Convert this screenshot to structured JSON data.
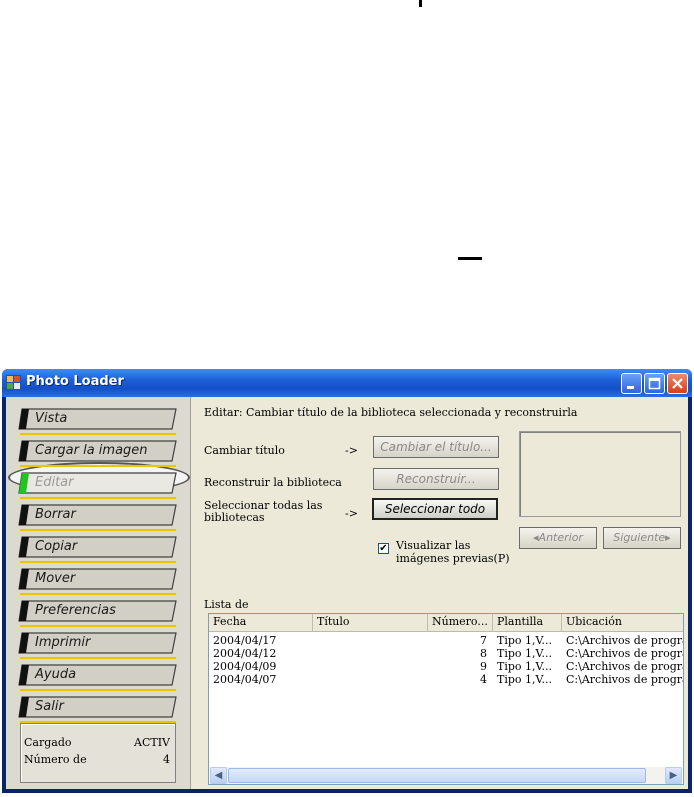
{
  "window": {
    "title": "Photo Loader"
  },
  "sidebar": {
    "items": [
      {
        "label": "Vista",
        "enabled": true
      },
      {
        "label": "Cargar la imagen",
        "enabled": true
      },
      {
        "label": "Editar",
        "enabled": false,
        "highlighted": true
      },
      {
        "label": "Borrar",
        "enabled": true
      },
      {
        "label": "Copiar",
        "enabled": true
      },
      {
        "label": "Mover",
        "enabled": true
      },
      {
        "label": "Preferencias",
        "enabled": true
      },
      {
        "label": "Imprimir",
        "enabled": true
      },
      {
        "label": "Ayuda",
        "enabled": true
      },
      {
        "label": "Salir",
        "enabled": true
      }
    ],
    "status": {
      "loaded_label": "Cargado",
      "loaded_value": "ACTIV",
      "number_label": "Número de",
      "number_value": "4"
    }
  },
  "main": {
    "description": "Editar: Cambiar título de la biblioteca seleccionada y reconstruirla",
    "actions": {
      "change_title_label": "Cambiar título",
      "change_title_arrow": "->",
      "change_title_button": "Cambiar el título...",
      "rebuild_label": "Reconstruir la biblioteca",
      "rebuild_button": "Reconstruir...",
      "select_all_label_line1": "Seleccionar todas las",
      "select_all_label_line2": "bibliotecas",
      "select_all_arrow": "->",
      "select_all_button": "Seleccionar todo"
    },
    "preview": {
      "checkbox_checked": true,
      "checkbox_label_line1": "Visualizar las",
      "checkbox_label_line2": "imágenes previas(P)",
      "prev_button": "Anterior",
      "next_button": "Siguiente"
    },
    "list": {
      "caption": "Lista de",
      "columns": [
        "Fecha",
        "Título",
        "Número...",
        "Plantilla",
        "Ubicación"
      ],
      "rows": [
        {
          "fecha": "2004/04/17",
          "titulo": "",
          "numero": "7",
          "plantilla": "Tipo 1,V...",
          "ubicacion": "C:\\Archivos de progra"
        },
        {
          "fecha": "2004/04/12",
          "titulo": "",
          "numero": "8",
          "plantilla": "Tipo 1,V...",
          "ubicacion": "C:\\Archivos de progra"
        },
        {
          "fecha": "2004/04/09",
          "titulo": "",
          "numero": "9",
          "plantilla": "Tipo 1,V...",
          "ubicacion": "C:\\Archivos de progra"
        },
        {
          "fecha": "2004/04/07",
          "titulo": "",
          "numero": "4",
          "plantilla": "Tipo 1,V...",
          "ubicacion": "C:\\Archivos de progra"
        }
      ]
    }
  },
  "colors": {
    "titlebar": "#1d5fd6",
    "client_bg": "#ece9d8",
    "separator": "#f0c400",
    "enabled_indicator": "#22c422"
  }
}
